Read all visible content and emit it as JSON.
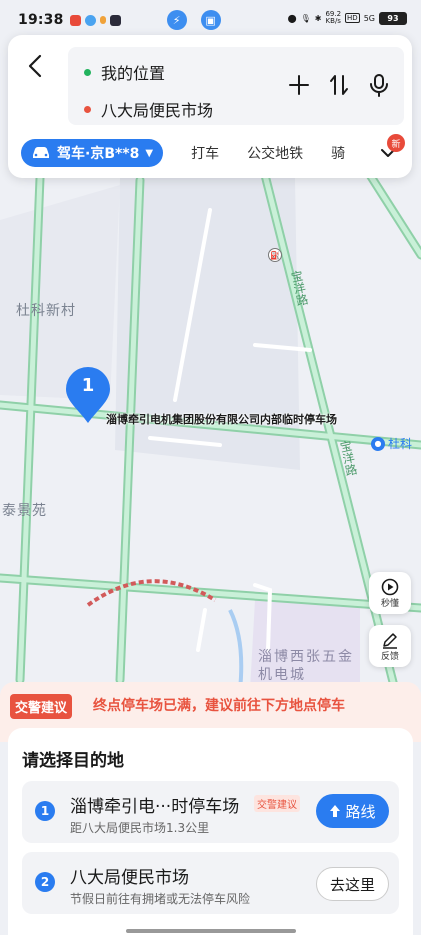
{
  "status_bar": {
    "time": "19:38",
    "net_speed_value": "69.2",
    "net_speed_unit": "KB/s",
    "hd_label": "HD",
    "signal_label": "5G",
    "battery": "93"
  },
  "route": {
    "origin": "我的位置",
    "destination": "八大局便民市场",
    "origin_color": "#22b35e",
    "destination_color": "#e8533f"
  },
  "modes": {
    "active": "驾车·京B**8",
    "items": [
      "打车",
      "公交地铁",
      "骑"
    ],
    "new_badge": "新"
  },
  "map": {
    "labels": {
      "village": "杜科新村",
      "taijing": "泰景苑",
      "road_1": "宝洋路",
      "road_2": "宝洋路",
      "du_ke": "杜科",
      "xizhang": "淄博西张五金机电城"
    },
    "marker_number": "1",
    "marker_label": "淄博牵引电机集团股份有限公司内部临时停车场",
    "side_buttons": {
      "play": "秒懂",
      "feedback": "反馈"
    }
  },
  "advice": {
    "tag": "交警建议",
    "text": "终点停车场已满，建议前往下方地点停车"
  },
  "sheet": {
    "title": "请选择目的地",
    "destinations": [
      {
        "number": "1",
        "name": "淄博牵引电···时停车场",
        "tag": "交警建议",
        "sub": "距八大局便民市场1.3公里",
        "button": "路线"
      },
      {
        "number": "2",
        "name": "八大局便民市场",
        "sub": "节假日前往有拥堵或无法停车风险",
        "button": "去这里"
      }
    ]
  },
  "colors": {
    "accent": "#2a7cf0",
    "warning": "#e8533f",
    "road": "#b9e6c9",
    "road_edge": "#8fd0a8"
  }
}
